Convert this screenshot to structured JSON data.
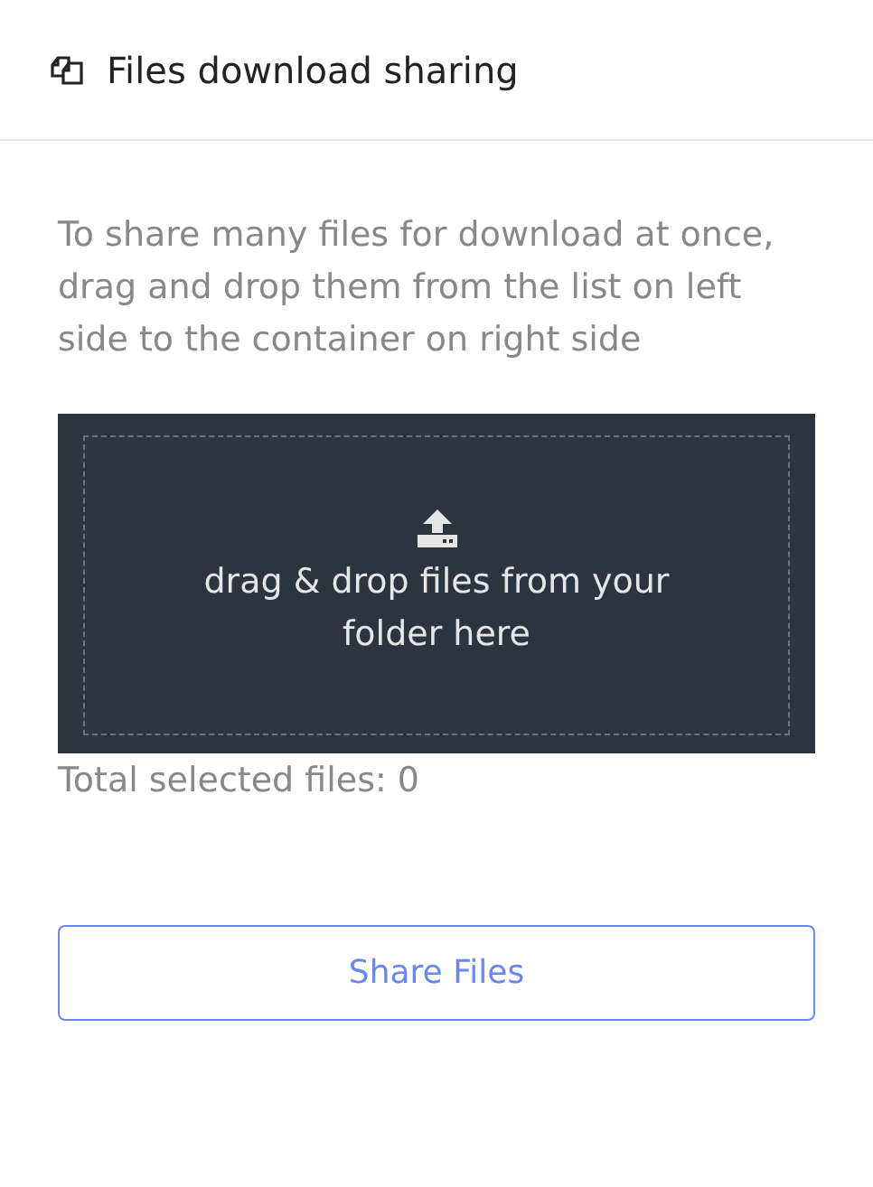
{
  "header": {
    "title": "Files download sharing"
  },
  "instructions": "To share many files for download at once, drag and drop them from the list on left side to the container on right side",
  "dropzone": {
    "text": "drag & drop files from your folder here"
  },
  "total": "Total selected files: 0",
  "button": "Share Files"
}
